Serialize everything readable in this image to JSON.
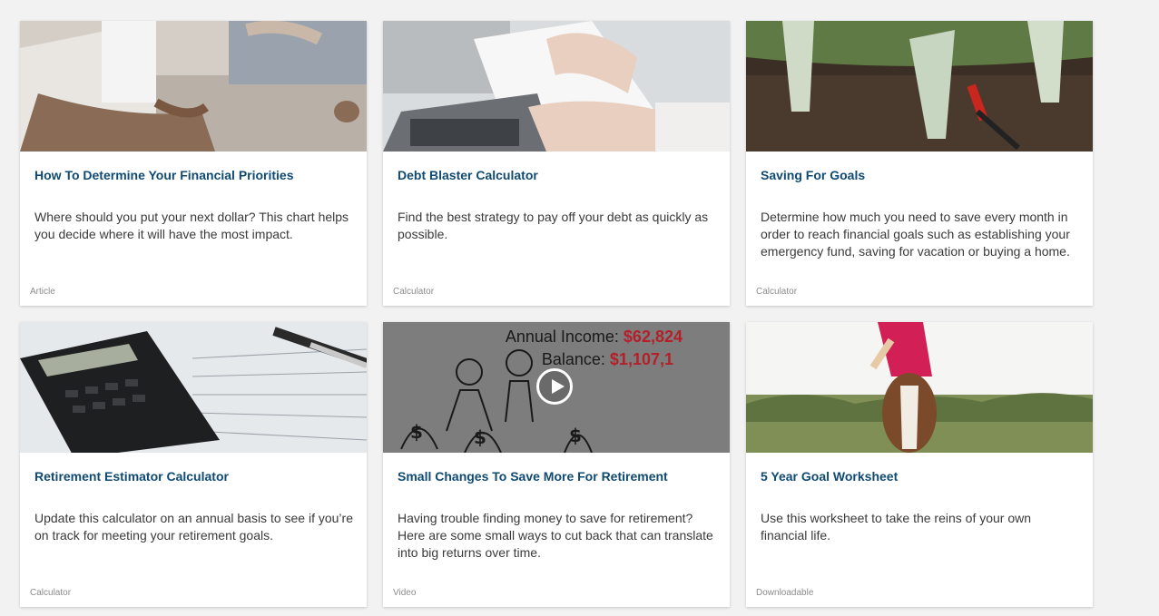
{
  "cards": [
    {
      "title": "How To Determine Your Financial Priorities",
      "description": "Where should you put your next dollar? This chart helps you decide where it will have the most impact.",
      "type": "Article",
      "image": "meditation-photo"
    },
    {
      "title": "Debt Blaster Calculator",
      "description": "Find the best strategy to pay off your debt as quickly as possible.",
      "type": "Calculator",
      "image": "calculator-hands-photo"
    },
    {
      "title": "Saving For Goals",
      "description": "Determine how much you need to save every month in order to reach financial goals such as establishing your emergency fund, saving for vacation or buying a home.",
      "type": "Calculator",
      "image": "money-plants-photo"
    },
    {
      "title": "Retirement Estimator Calculator",
      "description": "Update this calculator on an annual basis to see if you’re on track for meeting your retirement goals.",
      "type": "Calculator",
      "image": "calculator-paper-photo"
    },
    {
      "title": "Small Changes To Save More For Retirement",
      "description": "Having trouble finding money to save for retirement? Here are some small ways to cut back that can translate into big returns over time.",
      "type": "Video",
      "image": "video-thumbnail",
      "video_overlay": {
        "income_label": "Annual Income:",
        "income_value": "$62,824",
        "balance_label": "Balance:",
        "balance_value": "$1,107,1"
      }
    },
    {
      "title": "5 Year Goal Worksheet",
      "description": "Use this worksheet to take the reins of your own financial life.",
      "type": "Downloadable",
      "image": "horse-rider-photo"
    }
  ],
  "colors": {
    "title": "#0f4a73",
    "background": "#f2f2f2",
    "overlay_red": "#b3202a"
  }
}
